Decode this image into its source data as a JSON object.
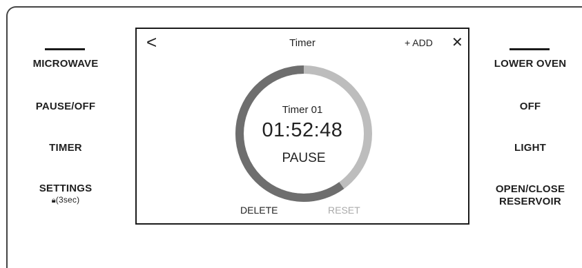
{
  "left_buttons": [
    {
      "label": "MICROWAVE",
      "selected": true
    },
    {
      "label": "PAUSE/OFF"
    },
    {
      "label": "TIMER"
    },
    {
      "label": "SETTINGS",
      "sublabel": "(3sec)",
      "icon": "lock-icon"
    }
  ],
  "right_buttons": [
    {
      "label": "LOWER OVEN",
      "selected": true
    },
    {
      "label": "OFF"
    },
    {
      "label": "LIGHT"
    },
    {
      "label": "OPEN/CLOSE",
      "label_line2": "RESERVOIR"
    }
  ],
  "screen": {
    "back_icon": "chevron-left-icon",
    "back_glyph": "<",
    "title": "Timer",
    "add_label": "+ ADD",
    "close_icon": "close-icon",
    "close_glyph": "✕",
    "timer": {
      "name": "Timer 01",
      "time": "01:52:48",
      "remaining_fraction": 0.6,
      "action_label": "PAUSE"
    },
    "delete_label": "DELETE",
    "reset_label": "RESET"
  },
  "colors": {
    "progress_remaining": "#6e6e6e",
    "progress_elapsed": "#bdbdbd",
    "reset_disabled": "#aaaaaa",
    "border": "#1a1a1a"
  }
}
